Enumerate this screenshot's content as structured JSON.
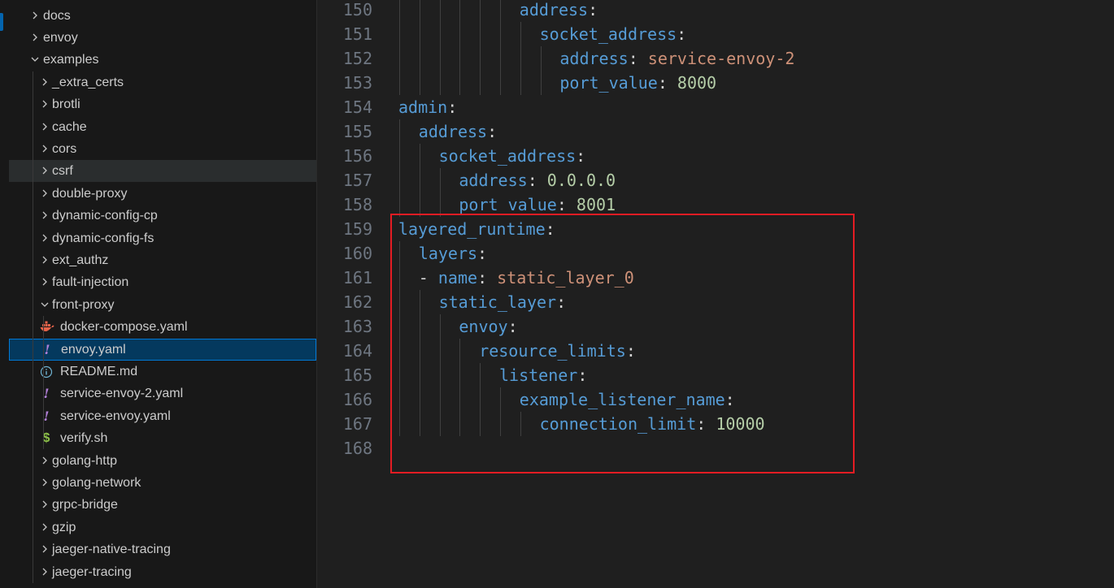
{
  "explorer": {
    "items": [
      {
        "label": "docs",
        "kind": "folder",
        "depth": 0,
        "open": false
      },
      {
        "label": "envoy",
        "kind": "folder",
        "depth": 0,
        "open": false
      },
      {
        "label": "examples",
        "kind": "folder",
        "depth": 0,
        "open": true
      },
      {
        "label": "_extra_certs",
        "kind": "folder",
        "depth": 1,
        "open": false
      },
      {
        "label": "brotli",
        "kind": "folder",
        "depth": 1,
        "open": false
      },
      {
        "label": "cache",
        "kind": "folder",
        "depth": 1,
        "open": false
      },
      {
        "label": "cors",
        "kind": "folder",
        "depth": 1,
        "open": false
      },
      {
        "label": "csrf",
        "kind": "folder",
        "depth": 1,
        "open": false,
        "state": "hover"
      },
      {
        "label": "double-proxy",
        "kind": "folder",
        "depth": 1,
        "open": false
      },
      {
        "label": "dynamic-config-cp",
        "kind": "folder",
        "depth": 1,
        "open": false
      },
      {
        "label": "dynamic-config-fs",
        "kind": "folder",
        "depth": 1,
        "open": false
      },
      {
        "label": "ext_authz",
        "kind": "folder",
        "depth": 1,
        "open": false
      },
      {
        "label": "fault-injection",
        "kind": "folder",
        "depth": 1,
        "open": false
      },
      {
        "label": "front-proxy",
        "kind": "folder",
        "depth": 1,
        "open": true
      },
      {
        "label": "docker-compose.yaml",
        "kind": "file",
        "icon": "docker-icon",
        "depth": 2
      },
      {
        "label": "envoy.yaml",
        "kind": "file",
        "icon": "yaml-icon",
        "depth": 2,
        "state": "selected"
      },
      {
        "label": "README.md",
        "kind": "file",
        "icon": "info-icon",
        "depth": 2
      },
      {
        "label": "service-envoy-2.yaml",
        "kind": "file",
        "icon": "yaml-icon",
        "depth": 2
      },
      {
        "label": "service-envoy.yaml",
        "kind": "file",
        "icon": "yaml-icon",
        "depth": 2
      },
      {
        "label": "verify.sh",
        "kind": "file",
        "icon": "shell-icon",
        "depth": 2
      },
      {
        "label": "golang-http",
        "kind": "folder",
        "depth": 1,
        "open": false
      },
      {
        "label": "golang-network",
        "kind": "folder",
        "depth": 1,
        "open": false
      },
      {
        "label": "grpc-bridge",
        "kind": "folder",
        "depth": 1,
        "open": false
      },
      {
        "label": "gzip",
        "kind": "folder",
        "depth": 1,
        "open": false
      },
      {
        "label": "jaeger-native-tracing",
        "kind": "folder",
        "depth": 1,
        "open": false
      },
      {
        "label": "jaeger-tracing",
        "kind": "folder",
        "depth": 1,
        "open": false
      }
    ]
  },
  "editor": {
    "highlight_color": "#e51c23",
    "lines": [
      {
        "n": "150",
        "indent": 6,
        "tokens": [
          [
            "k",
            "address"
          ],
          [
            "p",
            ":"
          ]
        ]
      },
      {
        "n": "151",
        "indent": 7,
        "tokens": [
          [
            "k",
            "socket_address"
          ],
          [
            "p",
            ":"
          ]
        ]
      },
      {
        "n": "152",
        "indent": 8,
        "tokens": [
          [
            "k",
            "address"
          ],
          [
            "p",
            ": "
          ],
          [
            "s",
            "service-envoy-2"
          ]
        ]
      },
      {
        "n": "153",
        "indent": 8,
        "tokens": [
          [
            "k",
            "port_value"
          ],
          [
            "p",
            ": "
          ],
          [
            "n",
            "8000"
          ]
        ]
      },
      {
        "n": "154",
        "indent": 0,
        "tokens": [
          [
            "k",
            "admin"
          ],
          [
            "p",
            ":"
          ]
        ]
      },
      {
        "n": "155",
        "indent": 1,
        "tokens": [
          [
            "k",
            "address"
          ],
          [
            "p",
            ":"
          ]
        ]
      },
      {
        "n": "156",
        "indent": 2,
        "tokens": [
          [
            "k",
            "socket_address"
          ],
          [
            "p",
            ":"
          ]
        ]
      },
      {
        "n": "157",
        "indent": 3,
        "tokens": [
          [
            "k",
            "address"
          ],
          [
            "p",
            ": "
          ],
          [
            "n",
            "0.0.0.0"
          ]
        ]
      },
      {
        "n": "158",
        "indent": 3,
        "tokens": [
          [
            "k",
            "port_value"
          ],
          [
            "p",
            ": "
          ],
          [
            "n",
            "8001"
          ]
        ]
      },
      {
        "n": "159",
        "indent": 0,
        "tokens": [
          [
            "k",
            "layered_runtime"
          ],
          [
            "p",
            ":"
          ]
        ]
      },
      {
        "n": "160",
        "indent": 1,
        "tokens": [
          [
            "k",
            "layers"
          ],
          [
            "p",
            ":"
          ]
        ]
      },
      {
        "n": "161",
        "indent": 1,
        "tokens": [
          [
            "p",
            "- "
          ],
          [
            "k",
            "name"
          ],
          [
            "p",
            ": "
          ],
          [
            "s",
            "static_layer_0"
          ]
        ]
      },
      {
        "n": "162",
        "indent": 2,
        "tokens": [
          [
            "k",
            "static_layer"
          ],
          [
            "p",
            ":"
          ]
        ]
      },
      {
        "n": "163",
        "indent": 3,
        "tokens": [
          [
            "k",
            "envoy"
          ],
          [
            "p",
            ":"
          ]
        ]
      },
      {
        "n": "164",
        "indent": 4,
        "tokens": [
          [
            "k",
            "resource_limits"
          ],
          [
            "p",
            ":"
          ]
        ]
      },
      {
        "n": "165",
        "indent": 5,
        "tokens": [
          [
            "k",
            "listener"
          ],
          [
            "p",
            ":"
          ]
        ]
      },
      {
        "n": "166",
        "indent": 6,
        "tokens": [
          [
            "k",
            "example_listener_name"
          ],
          [
            "p",
            ":"
          ]
        ]
      },
      {
        "n": "167",
        "indent": 7,
        "tokens": [
          [
            "k",
            "connection_limit"
          ],
          [
            "p",
            ": "
          ],
          [
            "n",
            "10000"
          ]
        ]
      },
      {
        "n": "168",
        "indent": 0,
        "tokens": []
      }
    ]
  }
}
